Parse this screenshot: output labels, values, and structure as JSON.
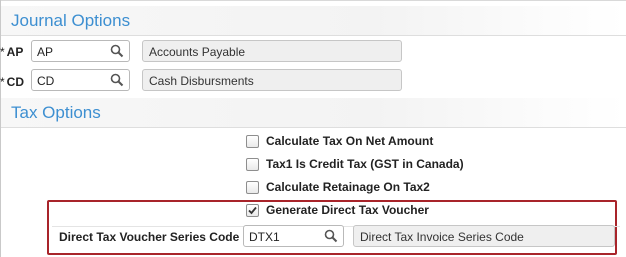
{
  "journal_options": {
    "title": "Journal Options",
    "rows": [
      {
        "required_mark": "*",
        "label": "AP",
        "value": "AP",
        "description": "Accounts Payable"
      },
      {
        "required_mark": "*",
        "label": "CD",
        "value": "CD",
        "description": "Cash Disbursments"
      }
    ]
  },
  "tax_options": {
    "title": "Tax Options",
    "checkboxes": [
      {
        "label": "Calculate Tax On Net Amount",
        "checked": false
      },
      {
        "label": "Tax1 Is Credit Tax (GST in Canada)",
        "checked": false
      },
      {
        "label": "Calculate Retainage On Tax2",
        "checked": false
      },
      {
        "label": "Generate Direct Tax Voucher",
        "checked": true
      }
    ],
    "series_code": {
      "label": "Direct Tax Voucher Series Code",
      "value": "DTX1",
      "description": "Direct Tax Invoice Series Code"
    }
  },
  "icons": {
    "lookup": "magnifier-icon",
    "check": "checkmark-icon"
  },
  "colors": {
    "section_title": "#3d8fd1",
    "highlight_border": "#a8242a"
  }
}
